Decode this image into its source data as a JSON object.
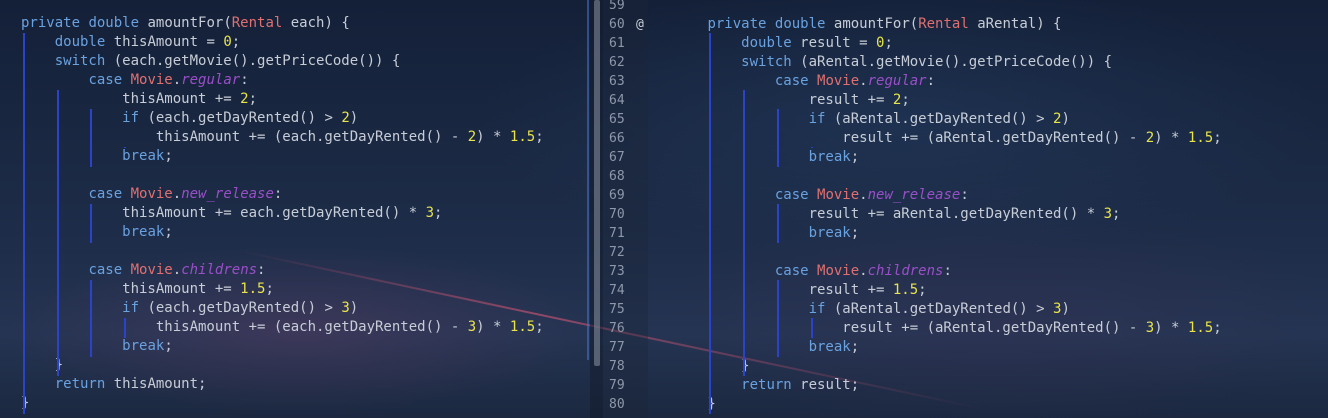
{
  "editor": {
    "left": {
      "lines": [
        [
          [
            "kw",
            "private"
          ],
          [
            "pl",
            " "
          ],
          [
            "kw",
            "double"
          ],
          [
            "pl",
            " amountFor("
          ],
          [
            "cls",
            "Rental"
          ],
          [
            "pl",
            " each) {"
          ]
        ],
        [
          [
            "pl",
            "    "
          ],
          [
            "kw",
            "double"
          ],
          [
            "pl",
            " thisAmount = "
          ],
          [
            "num",
            "0"
          ],
          [
            "pl",
            ";"
          ]
        ],
        [
          [
            "pl",
            "    "
          ],
          [
            "kw",
            "switch"
          ],
          [
            "pl",
            " (each.getMovie().getPriceCode()) {"
          ]
        ],
        [
          [
            "pl",
            "        "
          ],
          [
            "kw",
            "case"
          ],
          [
            "pl",
            " "
          ],
          [
            "cls",
            "Movie"
          ],
          [
            "pl",
            "."
          ],
          [
            "fld",
            "regular"
          ],
          [
            "pl",
            ":"
          ]
        ],
        [
          [
            "pl",
            "            thisAmount += "
          ],
          [
            "num",
            "2"
          ],
          [
            "pl",
            ";"
          ]
        ],
        [
          [
            "pl",
            "            "
          ],
          [
            "kw",
            "if"
          ],
          [
            "pl",
            " (each.getDayRented() > "
          ],
          [
            "num",
            "2"
          ],
          [
            "pl",
            ")"
          ]
        ],
        [
          [
            "pl",
            "                thisAmount += (each.getDayRented() - "
          ],
          [
            "num",
            "2"
          ],
          [
            "pl",
            ") * "
          ],
          [
            "num",
            "1.5"
          ],
          [
            "pl",
            ";"
          ]
        ],
        [
          [
            "pl",
            "            "
          ],
          [
            "kw",
            "break"
          ],
          [
            "pl",
            ";"
          ]
        ],
        [],
        [
          [
            "pl",
            "        "
          ],
          [
            "kw",
            "case"
          ],
          [
            "pl",
            " "
          ],
          [
            "cls",
            "Movie"
          ],
          [
            "pl",
            "."
          ],
          [
            "fld",
            "new_release"
          ],
          [
            "pl",
            ":"
          ]
        ],
        [
          [
            "pl",
            "            thisAmount += each.getDayRented() * "
          ],
          [
            "num",
            "3"
          ],
          [
            "pl",
            ";"
          ]
        ],
        [
          [
            "pl",
            "            "
          ],
          [
            "kw",
            "break"
          ],
          [
            "pl",
            ";"
          ]
        ],
        [],
        [
          [
            "pl",
            "        "
          ],
          [
            "kw",
            "case"
          ],
          [
            "pl",
            " "
          ],
          [
            "cls",
            "Movie"
          ],
          [
            "pl",
            "."
          ],
          [
            "fld",
            "childrens"
          ],
          [
            "pl",
            ":"
          ]
        ],
        [
          [
            "pl",
            "            thisAmount += "
          ],
          [
            "num",
            "1.5"
          ],
          [
            "pl",
            ";"
          ]
        ],
        [
          [
            "pl",
            "            "
          ],
          [
            "kw",
            "if"
          ],
          [
            "pl",
            " (each.getDayRented() > "
          ],
          [
            "num",
            "3"
          ],
          [
            "pl",
            ")"
          ]
        ],
        [
          [
            "pl",
            "                thisAmount += (each.getDayRented() - "
          ],
          [
            "num",
            "3"
          ],
          [
            "pl",
            ") * "
          ],
          [
            "num",
            "1.5"
          ],
          [
            "pl",
            ";"
          ]
        ],
        [
          [
            "pl",
            "            "
          ],
          [
            "kw",
            "break"
          ],
          [
            "pl",
            ";"
          ]
        ],
        [
          [
            "pl",
            "    }"
          ]
        ],
        [
          [
            "pl",
            "    "
          ],
          [
            "kw",
            "return"
          ],
          [
            "pl",
            " thisAmount;"
          ]
        ],
        [
          [
            "pl",
            "}"
          ]
        ]
      ]
    },
    "right": {
      "line_numbers": [
        "59",
        "60",
        "61",
        "62",
        "63",
        "64",
        "65",
        "66",
        "67",
        "68",
        "69",
        "70",
        "71",
        "72",
        "73",
        "74",
        "75",
        "76",
        "77",
        "78",
        "79",
        "80"
      ],
      "override_marker": "@",
      "lines": [
        [],
        [
          [
            "pl",
            "        "
          ],
          [
            "kw",
            "private"
          ],
          [
            "pl",
            " "
          ],
          [
            "kw",
            "double"
          ],
          [
            "pl",
            " amountFor("
          ],
          [
            "cls",
            "Rental"
          ],
          [
            "pl",
            " aRental) {"
          ]
        ],
        [
          [
            "pl",
            "            "
          ],
          [
            "kw",
            "double"
          ],
          [
            "pl",
            " result = "
          ],
          [
            "num",
            "0"
          ],
          [
            "pl",
            ";"
          ]
        ],
        [
          [
            "pl",
            "            "
          ],
          [
            "kw",
            "switch"
          ],
          [
            "pl",
            " (aRental.getMovie().getPriceCode()) {"
          ]
        ],
        [
          [
            "pl",
            "                "
          ],
          [
            "kw",
            "case"
          ],
          [
            "pl",
            " "
          ],
          [
            "cls",
            "Movie"
          ],
          [
            "pl",
            "."
          ],
          [
            "fld",
            "regular"
          ],
          [
            "pl",
            ":"
          ]
        ],
        [
          [
            "pl",
            "                    result += "
          ],
          [
            "num",
            "2"
          ],
          [
            "pl",
            ";"
          ]
        ],
        [
          [
            "pl",
            "                    "
          ],
          [
            "kw",
            "if"
          ],
          [
            "pl",
            " (aRental.getDayRented() > "
          ],
          [
            "num",
            "2"
          ],
          [
            "pl",
            ")"
          ]
        ],
        [
          [
            "pl",
            "                        result += (aRental.getDayRented() - "
          ],
          [
            "num",
            "2"
          ],
          [
            "pl",
            ") * "
          ],
          [
            "num",
            "1.5"
          ],
          [
            "pl",
            ";"
          ]
        ],
        [
          [
            "pl",
            "                    "
          ],
          [
            "kw",
            "break"
          ],
          [
            "pl",
            ";"
          ]
        ],
        [],
        [
          [
            "pl",
            "                "
          ],
          [
            "kw",
            "case"
          ],
          [
            "pl",
            " "
          ],
          [
            "cls",
            "Movie"
          ],
          [
            "pl",
            "."
          ],
          [
            "fld",
            "new_release"
          ],
          [
            "pl",
            ":"
          ]
        ],
        [
          [
            "pl",
            "                    result += aRental.getDayRented() * "
          ],
          [
            "num",
            "3"
          ],
          [
            "pl",
            ";"
          ]
        ],
        [
          [
            "pl",
            "                    "
          ],
          [
            "kw",
            "break"
          ],
          [
            "pl",
            ";"
          ]
        ],
        [],
        [
          [
            "pl",
            "                "
          ],
          [
            "kw",
            "case"
          ],
          [
            "pl",
            " "
          ],
          [
            "cls",
            "Movie"
          ],
          [
            "pl",
            "."
          ],
          [
            "fld",
            "childrens"
          ],
          [
            "pl",
            ":"
          ]
        ],
        [
          [
            "pl",
            "                    result += "
          ],
          [
            "num",
            "1.5"
          ],
          [
            "pl",
            ";"
          ]
        ],
        [
          [
            "pl",
            "                    "
          ],
          [
            "kw",
            "if"
          ],
          [
            "pl",
            " (aRental.getDayRented() > "
          ],
          [
            "num",
            "3"
          ],
          [
            "pl",
            ")"
          ]
        ],
        [
          [
            "pl",
            "                        result += (aRental.getDayRented() - "
          ],
          [
            "num",
            "3"
          ],
          [
            "pl",
            ") * "
          ],
          [
            "num",
            "1.5"
          ],
          [
            "pl",
            ";"
          ]
        ],
        [
          [
            "pl",
            "                    "
          ],
          [
            "kw",
            "break"
          ],
          [
            "pl",
            ";"
          ]
        ],
        [
          [
            "pl",
            "            }"
          ]
        ],
        [
          [
            "pl",
            "            "
          ],
          [
            "kw",
            "return"
          ],
          [
            "pl",
            " result;"
          ]
        ],
        [
          [
            "pl",
            "        }"
          ]
        ]
      ]
    }
  }
}
